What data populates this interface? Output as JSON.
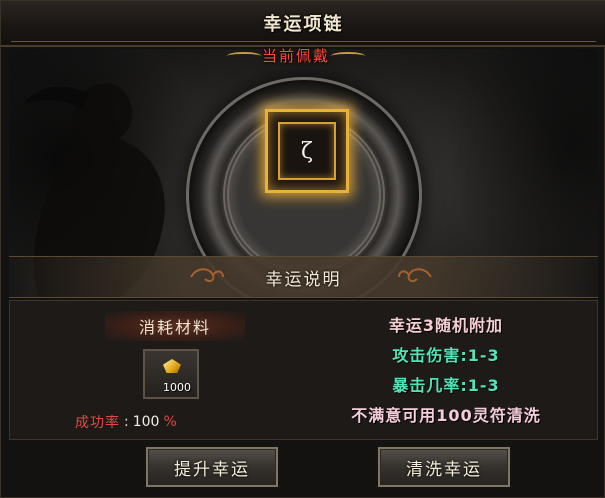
{
  "window": {
    "title": "幸运项链"
  },
  "equipped": {
    "label": "当前佩戴",
    "item_icon": "necklace-icon"
  },
  "description": {
    "title": "幸运说明"
  },
  "materials": {
    "title": "消耗材料",
    "item_icon": "gold-ingot-icon",
    "count": "1000"
  },
  "success_rate": {
    "label": "成功率",
    "colon": ":",
    "value": "100",
    "unit": "%"
  },
  "info": {
    "line1": "幸运3随机附加",
    "line2": "攻击伤害:1-3",
    "line3": "暴击几率:1-3",
    "line4": "不满意可用100灵符清洗"
  },
  "buttons": {
    "upgrade": "提升幸运",
    "wash": "清洗幸运"
  },
  "colors": {
    "title_text": "#f1e7cf",
    "equip_label": "#ff4b3a",
    "slot_glow": "#e6b23b",
    "info_green": "#52e3b6",
    "info_pink": "#f6cfd2",
    "rate_red": "#e04a42"
  }
}
